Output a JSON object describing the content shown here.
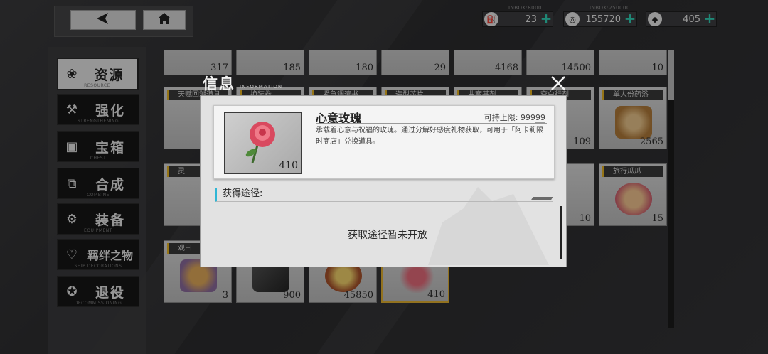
{
  "nav": {
    "back_icon": "back-arrow-icon",
    "home_icon": "home-icon"
  },
  "currencies": [
    {
      "caption": "INBOX:8000",
      "value": "23",
      "icon": "oil-icon"
    },
    {
      "caption": "INBOX:250000",
      "value": "155720",
      "icon": "coin-icon"
    },
    {
      "caption": "",
      "value": "405",
      "icon": "diamond-icon"
    }
  ],
  "sidebar": {
    "items": [
      {
        "label": "资源",
        "sub": "RESOURCE",
        "icon": "resource-icon",
        "active": true
      },
      {
        "label": "强化",
        "sub": "STRENGTHENING",
        "icon": "tools-icon"
      },
      {
        "label": "宝箱",
        "sub": "CHEST",
        "icon": "chest-icon"
      },
      {
        "label": "合成",
        "sub": "COMBINE",
        "icon": "combine-icon"
      },
      {
        "label": "装备",
        "sub": "EQUIPMENT",
        "icon": "equipment-icon"
      },
      {
        "label": "羁绊之物",
        "sub": "SHIP DECORATIONS",
        "icon": "bond-icon"
      },
      {
        "label": "退役",
        "sub": "DECOMMISSIONING",
        "icon": "retire-icon"
      }
    ]
  },
  "inventory": {
    "row1": [
      "317",
      "185",
      "180",
      "29",
      "4168",
      "14500",
      "10"
    ],
    "row2_tags": [
      "天赋回溯道具",
      "换装券",
      "紧急调遣书",
      "造型芯片",
      "曲案基剂",
      "空白行剂",
      "单人份药浴"
    ],
    "row2_counts": [
      "",
      "",
      "",
      "",
      "",
      "109",
      "2565"
    ],
    "row3_tags": [
      "灵",
      "",
      "",
      "",
      "",
      "",
      "旅行瓜瓜"
    ],
    "row3_counts": [
      "",
      "",
      "",
      "",
      "",
      "10",
      "15"
    ],
    "row4_tags": [
      "观曰",
      "",
      "",
      "",
      "",
      "",
      ""
    ],
    "row4_counts": [
      "3",
      "900",
      "45850",
      "410"
    ]
  },
  "modal": {
    "title": "信息",
    "subtitle": "INFORMATION",
    "item": {
      "name": "心意玫瑰",
      "limit": "可持上限: 99999",
      "count": "410",
      "description": "承载着心意与祝福的玫瑰。通过分解好感度礼物获取，可用于「阿卡莉限时商店」兑换道具。"
    },
    "source_heading": "获得途径:",
    "source_empty": "获取途径暂未开放"
  }
}
